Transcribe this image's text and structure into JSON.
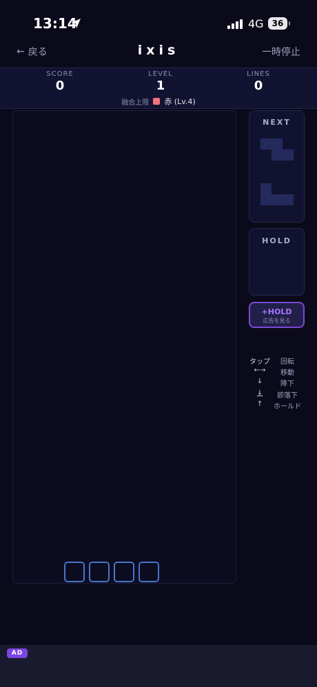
{
  "status": {
    "time": "13:14",
    "network": "4G",
    "battery": "36"
  },
  "nav": {
    "back_label": "戻る",
    "title": "ixis",
    "pause_label": "一時停止"
  },
  "stats": {
    "score_label": "SCORE",
    "score": "0",
    "level_label": "LEVEL",
    "level": "1",
    "lines_label": "LINES",
    "lines": "0"
  },
  "fusion": {
    "label": "融合上限",
    "value": "赤 (Lv.4)",
    "color": "#f0737d"
  },
  "next": {
    "title": "NEXT"
  },
  "hold": {
    "title": "HOLD"
  },
  "hold_button": {
    "label": "+HOLD",
    "sublabel": "広告を見る"
  },
  "controls": [
    {
      "key": "タップ",
      "action": "回転"
    },
    {
      "key": "←→",
      "action": "移動"
    },
    {
      "key": "↓",
      "action": "降下"
    },
    {
      "key": "↓",
      "action": "即落下"
    },
    {
      "key": "↑",
      "action": "ホールド"
    }
  ],
  "ad": {
    "badge": "AD"
  },
  "colors": {
    "background": "#0b0a1a",
    "accent": "#7b49d6",
    "ghost": "#4a74c8"
  }
}
